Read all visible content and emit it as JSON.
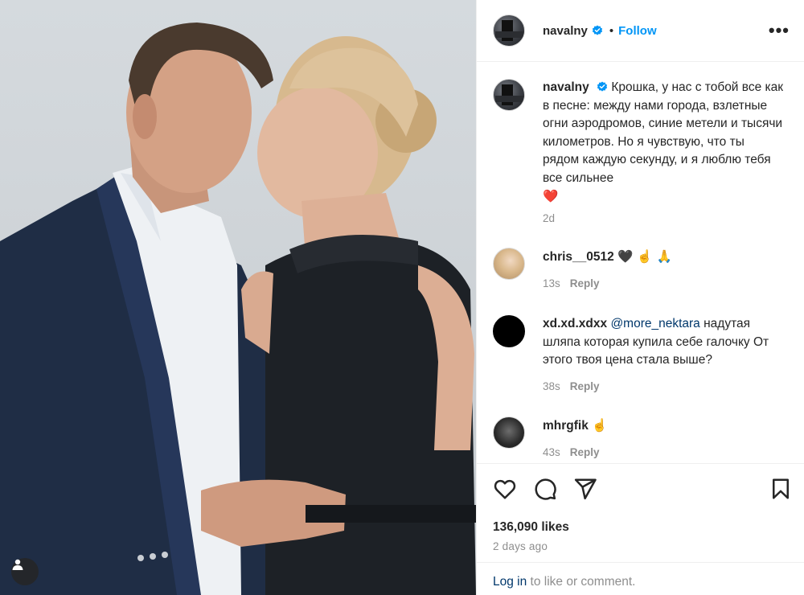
{
  "post": {
    "author": "navalny",
    "follow_label": "Follow",
    "separator": "•",
    "more_label": "•••"
  },
  "caption": {
    "username": "navalny",
    "text": "Крошка, у нас с тобой все как в песне: между нами города, взлетные огни аэродромов, синие метели и тысячи километров. Но я чувствую, что ты рядом каждую секунду, и я люблю тебя все сильнее",
    "emoji": "❤️",
    "time": "2d"
  },
  "comments": [
    {
      "username": "chris__0512",
      "text": "🖤 ☝️ 🙏",
      "time": "13s",
      "reply_label": "Reply"
    },
    {
      "username": "xd.xd.xdxx",
      "mention": "@more_nektara",
      "text": " надутая шляпа которая купила себе галочку От этого твоя цена стала выше?",
      "time": "38s",
      "reply_label": "Reply"
    },
    {
      "username": "mhrgfik",
      "text": "☝️",
      "time": "43s",
      "reply_label": "Reply"
    }
  ],
  "stats": {
    "likes": "136,090 likes",
    "posted": "2 days ago"
  },
  "login": {
    "link": "Log in",
    "text": " to like or comment."
  },
  "icons": {
    "like": "heart-icon",
    "comment": "comment-icon",
    "share": "share-icon",
    "save": "bookmark-icon",
    "tag": "user-tag-icon",
    "verified": "verified-badge-icon"
  },
  "colors": {
    "accent": "#0095f6",
    "link": "#00376b",
    "muted": "#8e8e8e",
    "heart": "#ed4956"
  }
}
